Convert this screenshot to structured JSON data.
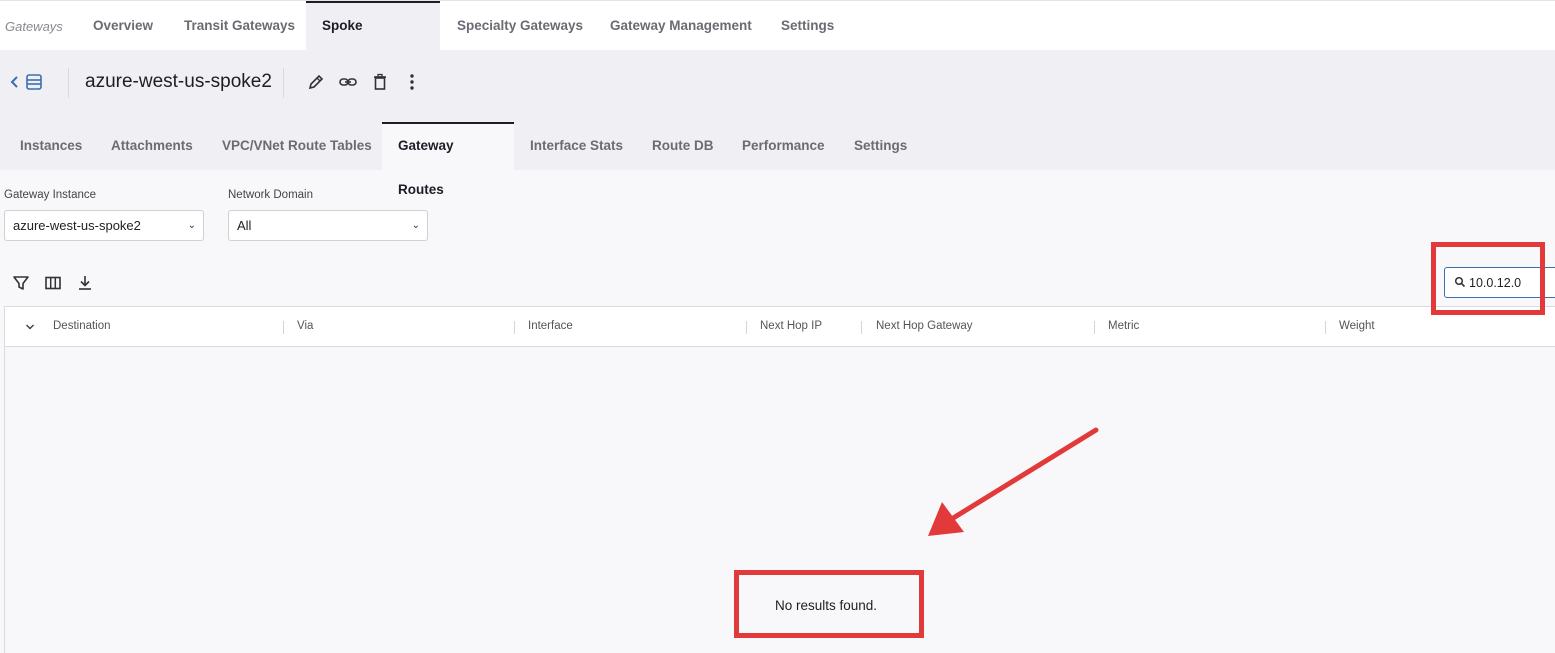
{
  "top_nav": {
    "breadcrumb": "Gateways",
    "tabs": [
      {
        "label": "Overview"
      },
      {
        "label": "Transit Gateways"
      },
      {
        "label": "Spoke Gateways",
        "active": true
      },
      {
        "label": "Specialty Gateways"
      },
      {
        "label": "Gateway Management"
      },
      {
        "label": "Settings"
      }
    ]
  },
  "gateway": {
    "name": "azure-west-us-spoke2",
    "actions": [
      "edit-icon",
      "link-icon",
      "delete-icon",
      "more-vertical-icon"
    ]
  },
  "sub_tabs": [
    {
      "label": "Instances"
    },
    {
      "label": "Attachments"
    },
    {
      "label": "VPC/VNet Route Tables"
    },
    {
      "label": "Gateway Routes",
      "active": true
    },
    {
      "label": "Interface Stats"
    },
    {
      "label": "Route DB"
    },
    {
      "label": "Performance"
    },
    {
      "label": "Settings"
    }
  ],
  "filters": {
    "gateway_instance": {
      "label": "Gateway Instance",
      "value": "azure-west-us-spoke2"
    },
    "network_domain": {
      "label": "Network Domain",
      "value": "All"
    }
  },
  "toolbar": {
    "icons": [
      "filter-icon",
      "columns-icon",
      "download-icon"
    ],
    "search_value": "10.0.12.0"
  },
  "table": {
    "columns": [
      "Destination",
      "Via",
      "Interface",
      "Next Hop IP",
      "Next Hop Gateway",
      "Metric",
      "Weight"
    ],
    "rows": [],
    "empty_message": "No results found."
  },
  "colors": {
    "accent_blue": "#3a6fb0",
    "annotation_red": "#e23a3a",
    "active_tab_border": "#1d1d26"
  }
}
